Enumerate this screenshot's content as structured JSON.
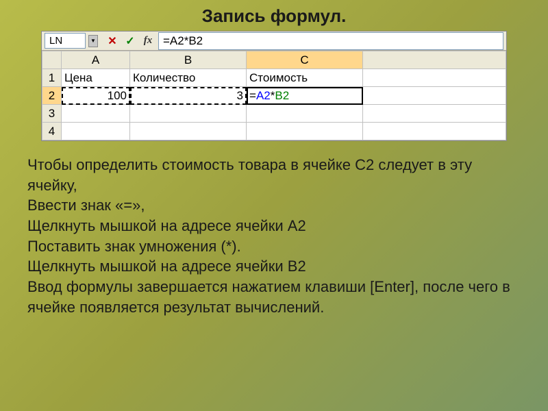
{
  "title": "Запись формул.",
  "formula_bar": {
    "name_box": "LN",
    "cancel": "✕",
    "confirm": "✓",
    "fx": "fx",
    "formula": "=A2*B2"
  },
  "grid": {
    "col_headers": [
      "A",
      "B",
      "C"
    ],
    "row_headers": [
      "1",
      "2",
      "3",
      "4"
    ],
    "r1c1": "Цена",
    "r1c2": "Количество",
    "r1c3": "Стоимость",
    "r2c1": "100",
    "r2c2": "3",
    "r2c3_prefix": "=",
    "r2c3_refA": "A2",
    "r2c3_op": "*",
    "r2c3_refB": "B2"
  },
  "body": {
    "l1": "Чтобы определить стоимость товара в ячейке С2 следует в эту ячейку,",
    "l2": "Ввести знак «=»,",
    "l3": "Щелкнуть мышкой на адресе ячейки А2",
    "l4": "Поставить знак умножения (*).",
    "l5": "Щелкнуть мышкой на адресе ячейки В2",
    "l6": "Ввод формулы завершается нажатием клавиши [Enter], после чего в ячейке появляется результат вычислений."
  }
}
